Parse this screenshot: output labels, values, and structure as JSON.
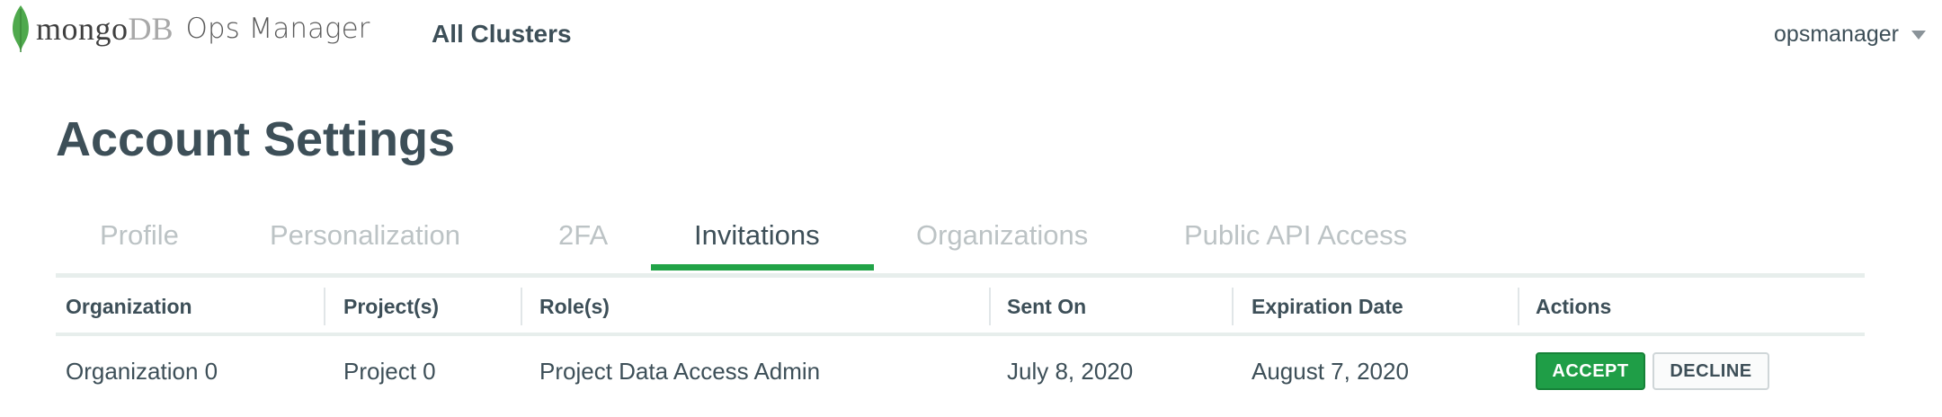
{
  "header": {
    "logo_mongo": "mongo",
    "logo_db": "DB",
    "product_name": "Ops Manager",
    "nav_all_clusters": "All Clusters",
    "user_name": "opsmanager"
  },
  "page": {
    "title": "Account Settings"
  },
  "tabs": [
    {
      "label": "Profile",
      "active": false
    },
    {
      "label": "Personalization",
      "active": false
    },
    {
      "label": "2FA",
      "active": false
    },
    {
      "label": "Invitations",
      "active": true
    },
    {
      "label": "Organizations",
      "active": false
    },
    {
      "label": "Public API Access",
      "active": false
    }
  ],
  "table": {
    "columns": [
      "Organization",
      "Project(s)",
      "Role(s)",
      "Sent On",
      "Expiration Date",
      "Actions"
    ],
    "rows": [
      {
        "organization": "Organization 0",
        "projects": "Project 0",
        "roles": "Project Data Access Admin",
        "sent_on": "July 8, 2020",
        "expiration": "August 7, 2020",
        "accept_label": "ACCEPT",
        "decline_label": "DECLINE"
      }
    ]
  },
  "colors": {
    "accent_green": "#21a347",
    "accept_button": "#1f9e47",
    "text_primary": "#3d4f58",
    "tab_inactive": "#bcc3c5",
    "divider": "#e7eeec"
  },
  "icons": {
    "logo_leaf": "mongodb-leaf-icon",
    "user_menu_caret": "caret-down-icon"
  }
}
